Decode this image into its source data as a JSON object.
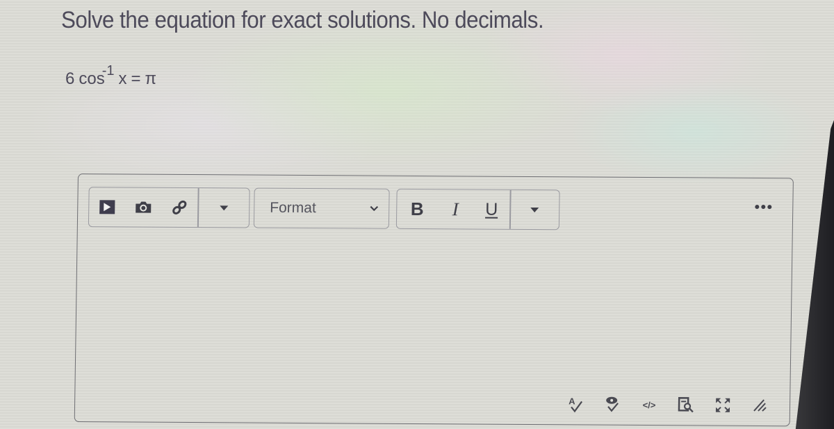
{
  "question": {
    "prompt": "Solve the equation for exact solutions. No decimals.",
    "equation": {
      "coefficient": "6",
      "function": "cos",
      "exponent": "-1",
      "variable": "x",
      "equals": "=",
      "rhs": "π"
    }
  },
  "editor": {
    "toolbar": {
      "media_group": [
        {
          "icon": "media-play-icon",
          "label": "Record/Upload Media"
        },
        {
          "icon": "camera-icon",
          "label": "Images"
        },
        {
          "icon": "link-icon",
          "label": "Links"
        },
        {
          "icon": "caret-down-icon",
          "label": "More media options"
        }
      ],
      "format_select": {
        "selected": "Format",
        "icon": "chevron-down-icon"
      },
      "style_group": [
        {
          "icon": "bold-icon",
          "glyph": "B",
          "label": "Bold"
        },
        {
          "icon": "italic-icon",
          "glyph": "I",
          "label": "Italic"
        },
        {
          "icon": "underline-icon",
          "glyph": "U",
          "label": "Underline"
        },
        {
          "icon": "caret-down-icon",
          "label": "More text styles"
        }
      ],
      "more_icon": "more-horizontal-icon"
    },
    "content": "",
    "status_bar": [
      {
        "icon": "spellcheck-icon",
        "label": "Spell check"
      },
      {
        "icon": "accessibility-checker-icon",
        "label": "Accessibility checker"
      },
      {
        "icon": "html-editor-icon",
        "glyph": "</>",
        "label": "HTML editor"
      },
      {
        "icon": "find-in-page-icon",
        "label": "Find"
      },
      {
        "icon": "fullscreen-icon",
        "label": "Fullscreen"
      },
      {
        "icon": "resize-handle-icon",
        "label": "Resize"
      }
    ]
  }
}
